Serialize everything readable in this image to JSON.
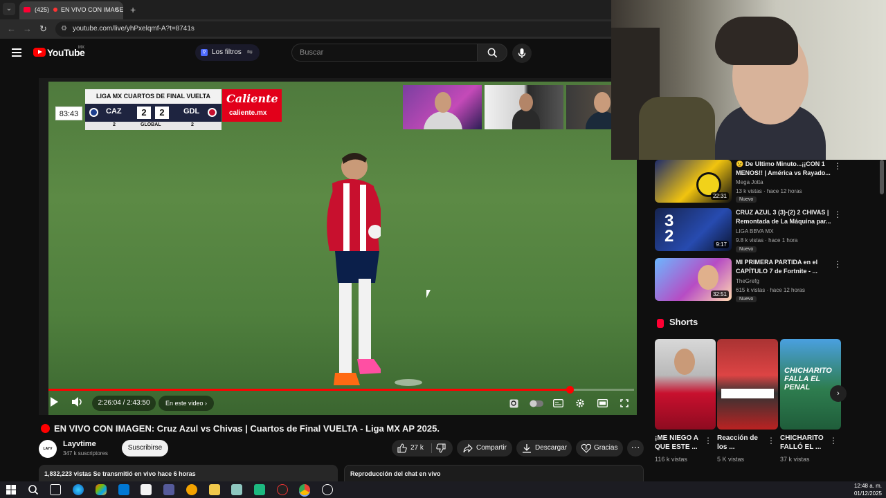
{
  "browser": {
    "tab_count": "(425)",
    "tab_title": "EN VIVO CON IMAGEN",
    "url": "youtube.com/live/yhPxelqmf-A?t=8741s"
  },
  "header": {
    "logo_text": "YouTube",
    "country": "MX",
    "filters_label": "Los filtros",
    "search_placeholder": "Buscar"
  },
  "scorebug": {
    "clock": "83:43",
    "title": "LIGA MX CUARTOS DE FINAL VUELTA",
    "home": "CAZ",
    "away": "GDL",
    "home_score": "2",
    "away_score": "2",
    "home_agg": "2",
    "away_agg": "2",
    "global_label": "GLOBAL",
    "sponsor_big": "Caliente",
    "sponsor_small": "caliente.mx"
  },
  "player": {
    "time_display": "2:26:04 / 2:43:50",
    "chapter_label": "En este video",
    "progress": 0.89
  },
  "video": {
    "title": "EN VIVO CON IMAGEN: Cruz Azul vs Chivas | Cuartos de Final VUELTA - Liga MX AP 2025.",
    "channel": "Layvtime",
    "subscribers": "347 k suscriptores",
    "subscribe_label": "Suscribirse",
    "likes": "27 k",
    "share_label": "Compartir",
    "download_label": "Descargar",
    "thanks_label": "Gracias",
    "views_line": "1,832,223 vistas  Se transmitió en vivo hace 6 horas",
    "chat_replay_label": "Reproducción del chat en vivo"
  },
  "recommendations": [
    {
      "title": "😉 De Ultimo Minuto...¡¡CON 1 MENOS!! | América vs Rayado...",
      "channel": "Mega Jotta",
      "meta": "13 k vistas · hace 12 horas",
      "badge": "Nuevo",
      "duration": "22:31"
    },
    {
      "title": "CRUZ AZUL 3 (3)-(2) 2 CHIVAS | Remontada de La Máquina par...",
      "channel": "LIGA BBVA MX",
      "meta": "9.8 k vistas · hace 1 hora",
      "badge": "Nuevo",
      "duration": "9:17"
    },
    {
      "title": "MI PRIMERA PARTIDA en el CAPÍTULO 7 de Fortnite - ...",
      "channel": "TheGrefg",
      "meta": "615 k vistas · hace 12 horas",
      "badge": "Nuevo",
      "duration": "32:51"
    }
  ],
  "shorts": {
    "heading": "Shorts",
    "items": [
      {
        "title": "¡ME NIEGO A QUE ESTE ...",
        "views": "116 k vistas"
      },
      {
        "title": "Reacción de los ...",
        "views": "5 K vistas"
      },
      {
        "title": "CHICHARITO FALLÓ EL ...",
        "views": "37 k vistas"
      }
    ],
    "thumb_text_2": "CHICHARITO FALLA EL PENAL"
  },
  "taskbar": {
    "time": "12:48 a. m.",
    "date": "01/12/2025"
  }
}
